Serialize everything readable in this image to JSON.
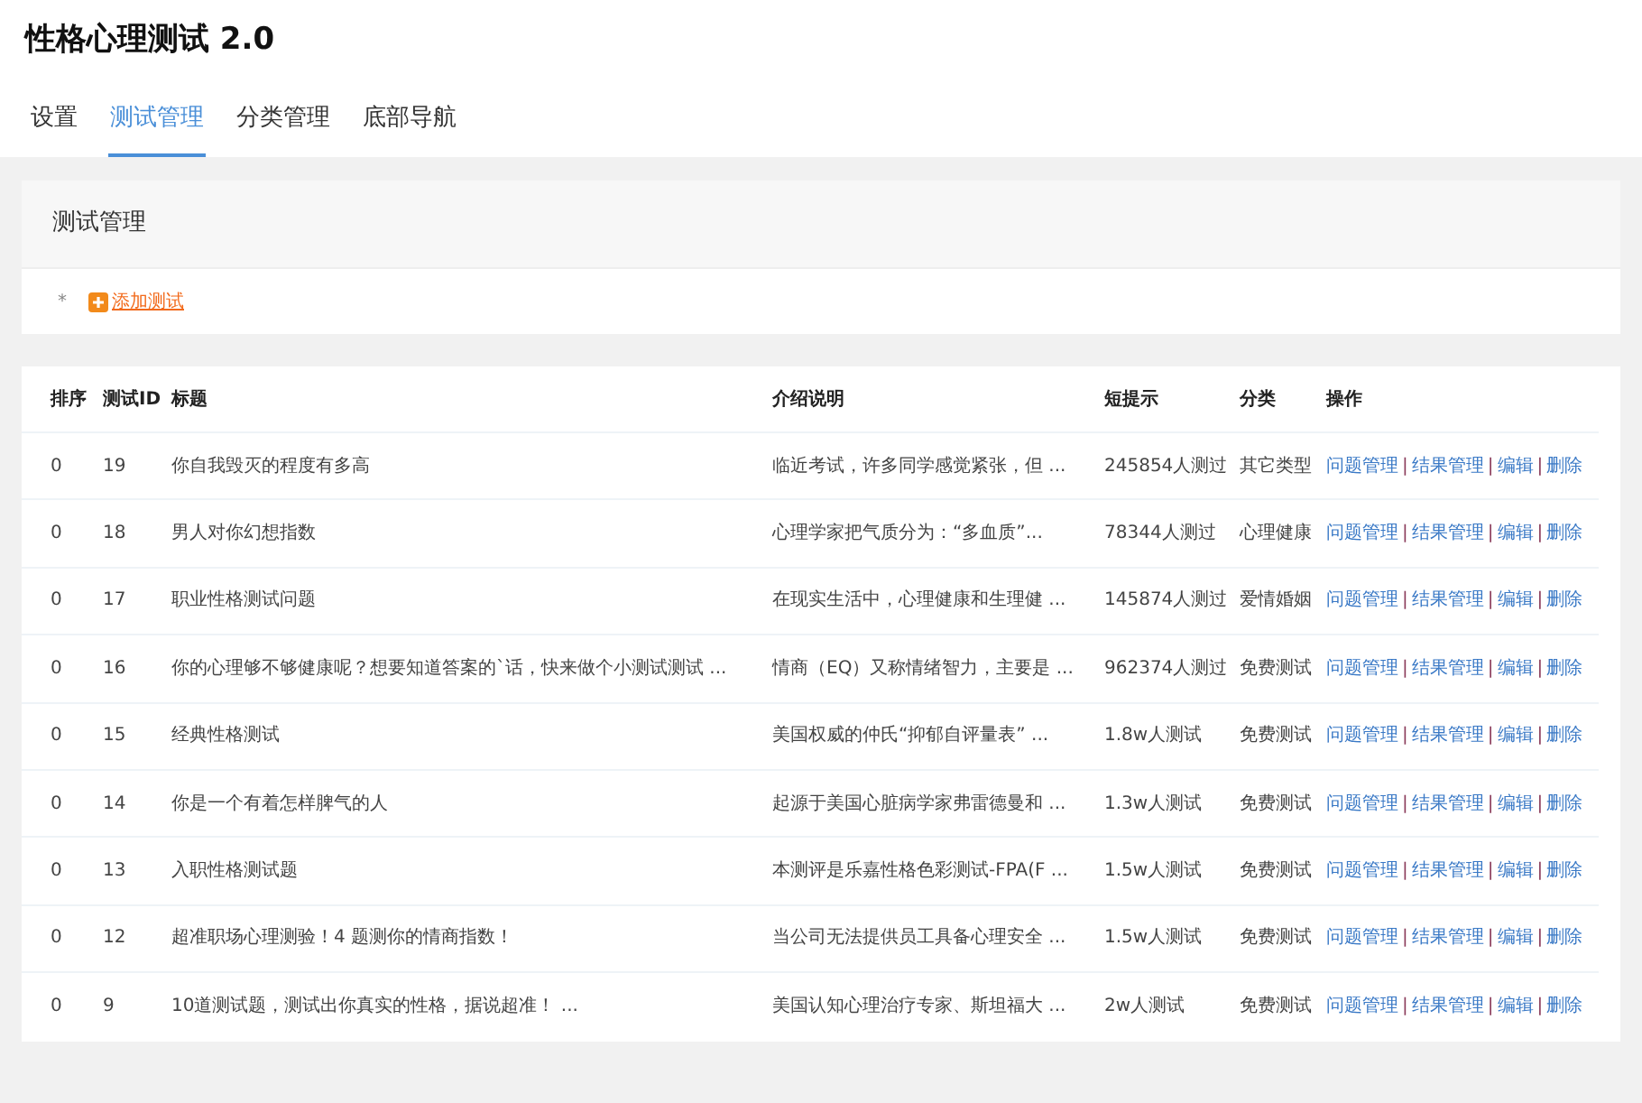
{
  "app_title": "性格心理测试 2.0",
  "tabs": [
    {
      "label": "设置",
      "selected": false
    },
    {
      "label": "测试管理",
      "selected": true
    },
    {
      "label": "分类管理",
      "selected": false
    },
    {
      "label": "底部导航",
      "selected": false
    }
  ],
  "panel": {
    "title": "测试管理",
    "bullet": "*",
    "add_link": "添加测试"
  },
  "table": {
    "columns": [
      "排序",
      "测试ID",
      "标题",
      "介绍说明",
      "短提示",
      "分类",
      "操作"
    ],
    "rows": [
      {
        "cells": [
          "0",
          "19",
          "你自我毁灭的程度有多高",
          "临近考试，许多同学感觉紧张，但 ...",
          "245854人测过",
          "其它类型"
        ],
        "actions": [
          "问题管理",
          "结果管理",
          "编辑",
          "删除"
        ]
      },
      {
        "cells": [
          "0",
          "18",
          "男人对你幻想指数",
          "心理学家把气质分为：“多血质”...",
          "78344人测过",
          "心理健康"
        ],
        "actions": [
          "问题管理",
          "结果管理",
          "编辑",
          "删除"
        ]
      },
      {
        "cells": [
          "0",
          "17",
          "职业性格测试问题",
          "在现实生活中，心理健康和生理健 ...",
          "145874人测过",
          "爱情婚姻"
        ],
        "actions": [
          "问题管理",
          "结果管理",
          "编辑",
          "删除"
        ]
      },
      {
        "cells": [
          "0",
          "16",
          "你的心理够不够健康呢？想要知道答案的`话，快来做个小测试测试 ...",
          "情商（EQ）又称情绪智力，主要是 ...",
          "962374人测过",
          "免费测试"
        ],
        "actions": [
          "问题管理",
          "结果管理",
          "编辑",
          "删除"
        ]
      },
      {
        "cells": [
          "0",
          "15",
          "经典性格测试",
          "美国权威的仲氏“抑郁自评量表” ...",
          "1.8w人测试",
          "免费测试"
        ],
        "actions": [
          "问题管理",
          "结果管理",
          "编辑",
          "删除"
        ]
      },
      {
        "cells": [
          "0",
          "14",
          "你是一个有着怎样脾气的人",
          "起源于美国心脏病学家弗雷德曼和 ...",
          "1.3w人测试",
          "免费测试"
        ],
        "actions": [
          "问题管理",
          "结果管理",
          "编辑",
          "删除"
        ]
      },
      {
        "cells": [
          "0",
          "13",
          "入职性格测试题",
          "本测评是乐嘉性格色彩测试-FPA(F ...",
          "1.5w人测试",
          "免费测试"
        ],
        "actions": [
          "问题管理",
          "结果管理",
          "编辑",
          "删除"
        ]
      },
      {
        "cells": [
          "0",
          "12",
          "超准职场心理测验！4 题测你的情商指数！",
          "当公司无法提供员工具备心理安全 ...",
          "1.5w人测试",
          "免费测试"
        ],
        "actions": [
          "问题管理",
          "结果管理",
          "编辑",
          "删除"
        ]
      },
      {
        "cells": [
          "0",
          "9",
          "10道测试题，测试出你真实的性格，据说超准！ ...",
          "美国认知心理治疗专家、斯坦福大 ...",
          "2w人测试",
          "免费测试"
        ],
        "actions": [
          "问题管理",
          "结果管理",
          "编辑",
          "删除"
        ]
      }
    ],
    "separator": "|"
  }
}
